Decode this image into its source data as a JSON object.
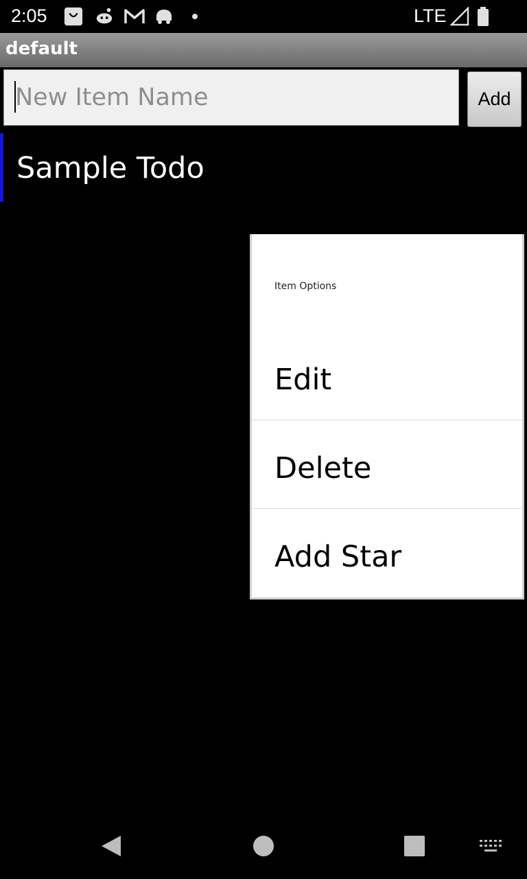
{
  "status_bar": {
    "time": "2:05",
    "network": "LTE",
    "notification_icons": [
      "shopping-bag-icon",
      "reddit-icon",
      "gmail-icon",
      "android-auto-icon",
      "dot-icon"
    ]
  },
  "title_bar": {
    "title": "default"
  },
  "input_row": {
    "placeholder": "New Item Name",
    "value": "",
    "add_label": "Add"
  },
  "todo_list": {
    "items": [
      {
        "label": "Sample Todo"
      }
    ]
  },
  "context_menu": {
    "title": "Item Options",
    "items": [
      {
        "label": "Edit"
      },
      {
        "label": "Delete"
      },
      {
        "label": "Add Star"
      }
    ]
  },
  "nav_bar": {
    "buttons": [
      "back-icon",
      "home-icon",
      "recents-icon",
      "keyboard-icon"
    ]
  },
  "colors": {
    "background": "#000000",
    "accent_marker": "#1515e0",
    "menu_background": "#ffffff"
  }
}
